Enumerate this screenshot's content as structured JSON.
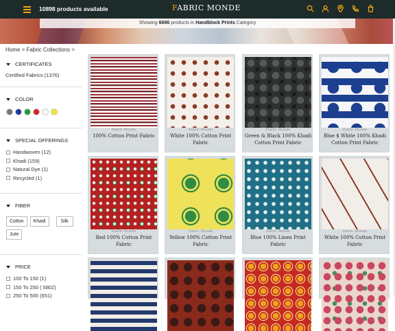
{
  "header": {
    "product_count": "10898 products available",
    "logo_prefix": "F",
    "logo_text": "ABRIC MONDE",
    "icons": [
      "search-icon",
      "user-icon",
      "location-icon",
      "phone-icon",
      "cart-icon"
    ],
    "accent": "#f2a516",
    "bg": "#1d2b2b"
  },
  "banner": {
    "showing_prefix": "Showing ",
    "showing_count": "6696",
    "showing_mid": " products in ",
    "category": "Handblock Prints",
    "showing_suffix": " Category"
  },
  "breadcrumb": "Home > Fabric Collections >",
  "sidebar": {
    "certificates": {
      "title": "CERTIFICATES",
      "items": [
        "Certified Fabrics (1376)"
      ]
    },
    "color": {
      "title": "COLOR",
      "swatches": [
        "#777777",
        "#1f3aa0",
        "#1e9a3b",
        "#d92222",
        "#f7f7f7",
        "#f2e52b"
      ]
    },
    "special": {
      "title": "SPECIAL OFFERINGS",
      "items": [
        "Handwoven (12)",
        "Khadi (159)",
        "Natural Dye (1)",
        "Recycled (1)"
      ]
    },
    "fiber": {
      "title": "FIBER",
      "chips": [
        "Cotton",
        "Khadi",
        "Silk",
        "Jute"
      ]
    },
    "price": {
      "title": "PRICE",
      "items": [
        "100 To 150 (1)",
        "150 To 250 ( 5802)",
        "250 To 500 (651)"
      ]
    }
  },
  "products": [
    {
      "brand": "Fabric Monde",
      "name": "100% Cotton Print Fabric",
      "pattern": "red-white-stripes"
    },
    {
      "brand": "Fabric Monde",
      "name": "White 100% Cotton Print Fabric",
      "pattern": "brown-tree-motif"
    },
    {
      "brand": "Fabric Monde",
      "name": "Green & Black  100% Khadi Cotton Print Fabric",
      "pattern": "dark-floral"
    },
    {
      "brand": "Fabric Monde",
      "name": "Blue $ White  100% Khadi Cotton Print Fabric",
      "pattern": "indigo-floral"
    },
    {
      "brand": "Fabric Monde",
      "name": "Red 100% Cotton Print Fabric",
      "pattern": "red-green-floral"
    },
    {
      "brand": "Fabric Monde",
      "name": "Yellow 100% Cotton Print Fabric",
      "pattern": "yellow-green-circles"
    },
    {
      "brand": "Fabric Monde",
      "name": "Blue 100% Linen Print Fabric",
      "pattern": "teal-dots"
    },
    {
      "brand": "Fabric Monde",
      "name": "White 100% Cotton Print Fabric",
      "pattern": "brown-swirl"
    },
    {
      "brand": "",
      "name": "",
      "pattern": "navy-chevrons"
    },
    {
      "brand": "",
      "name": "",
      "pattern": "rust-paisley"
    },
    {
      "brand": "",
      "name": "",
      "pattern": "red-orange-floral"
    },
    {
      "brand": "",
      "name": "",
      "pattern": "pink-green-floral"
    }
  ]
}
